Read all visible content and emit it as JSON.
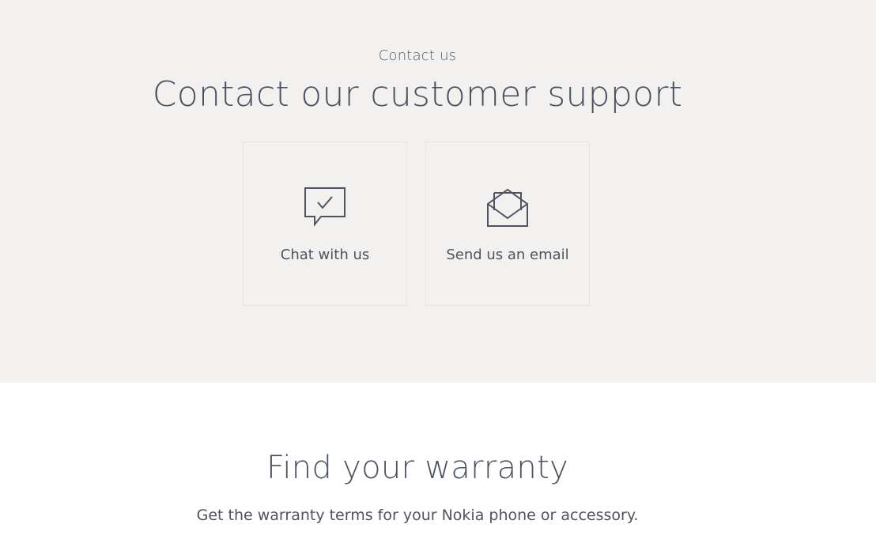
{
  "contact": {
    "eyebrow": "Contact us",
    "title": "Contact our customer support",
    "cards": [
      {
        "label": "Chat with us",
        "icon": "chat-check-icon"
      },
      {
        "label": "Send us an email",
        "icon": "envelope-open-icon"
      }
    ]
  },
  "warranty": {
    "title": "Find your warranty",
    "text": "Get the warranty terms for your Nokia phone or accessory."
  },
  "colors": {
    "section_background": "#f2f1ef",
    "text": "#4e5461",
    "card_border": "#e6e4e0",
    "icon_stroke": "#4e5461"
  }
}
